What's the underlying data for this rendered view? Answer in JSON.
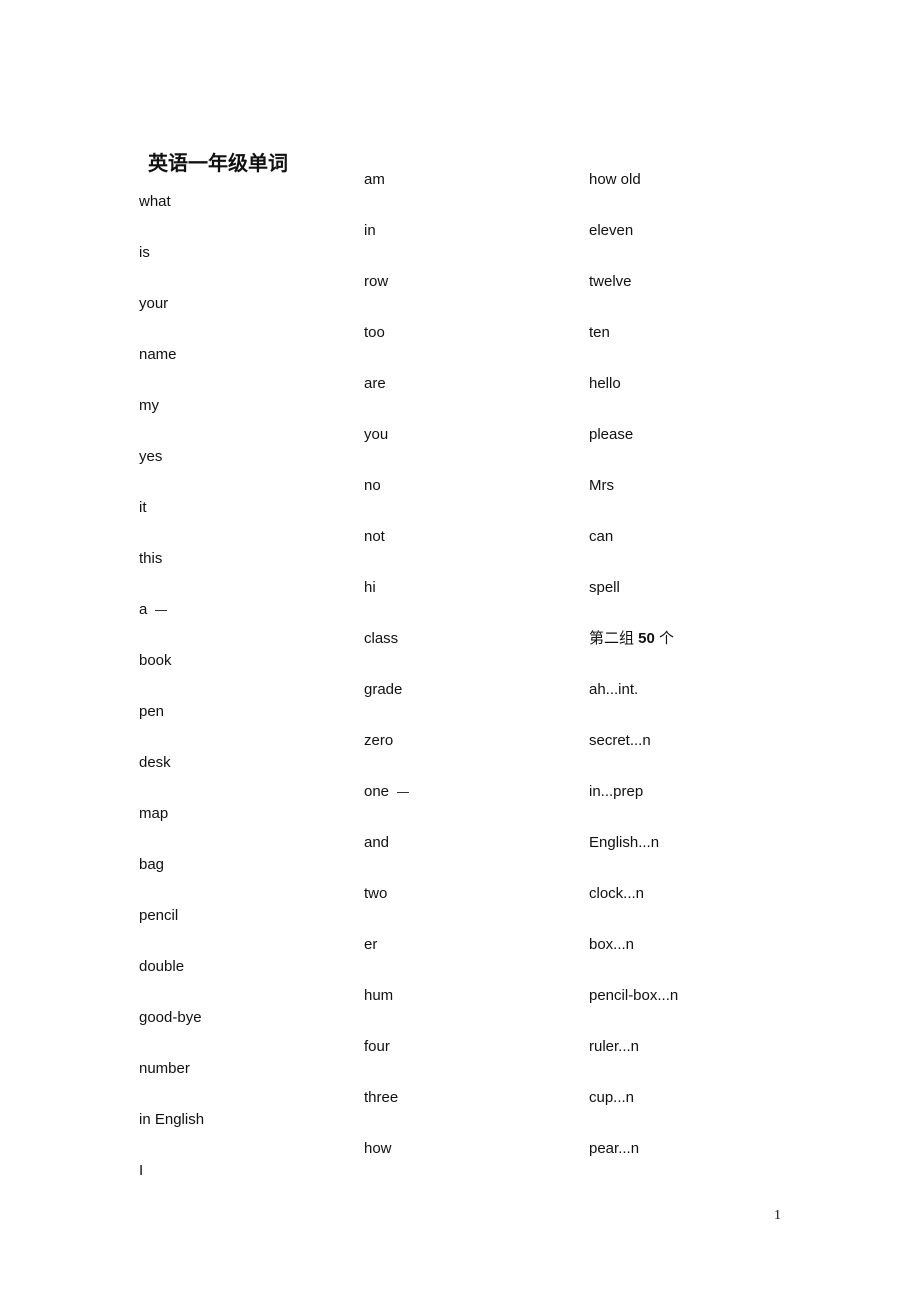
{
  "title": "英语一年级单词",
  "columns": [
    {
      "items": [
        "what",
        "is",
        "your",
        "name",
        "my",
        "yes",
        "it",
        "this",
        "a 一",
        "book",
        "pen",
        "desk",
        "map",
        "bag",
        "pencil",
        "double",
        "good-bye",
        "number",
        "in English",
        "I"
      ]
    },
    {
      "items": [
        "am",
        "in",
        "row",
        "too",
        "are",
        "you",
        "no",
        "not",
        "hi",
        "class",
        "grade",
        "zero",
        "one 一",
        "and",
        "two",
        "er",
        "hum",
        "four",
        "three",
        "how"
      ]
    },
    {
      "items": [
        "how old",
        "eleven",
        "twelve",
        "ten",
        "hello",
        "please",
        "Mrs",
        "can",
        "spell",
        "第二组 50 个",
        "ah...int.",
        "secret...n",
        "in...prep",
        "English...n",
        "clock...n",
        "box...n",
        "pencil-box...n",
        "ruler...n",
        "cup...n",
        "pear...n"
      ]
    }
  ],
  "page_number": "1"
}
